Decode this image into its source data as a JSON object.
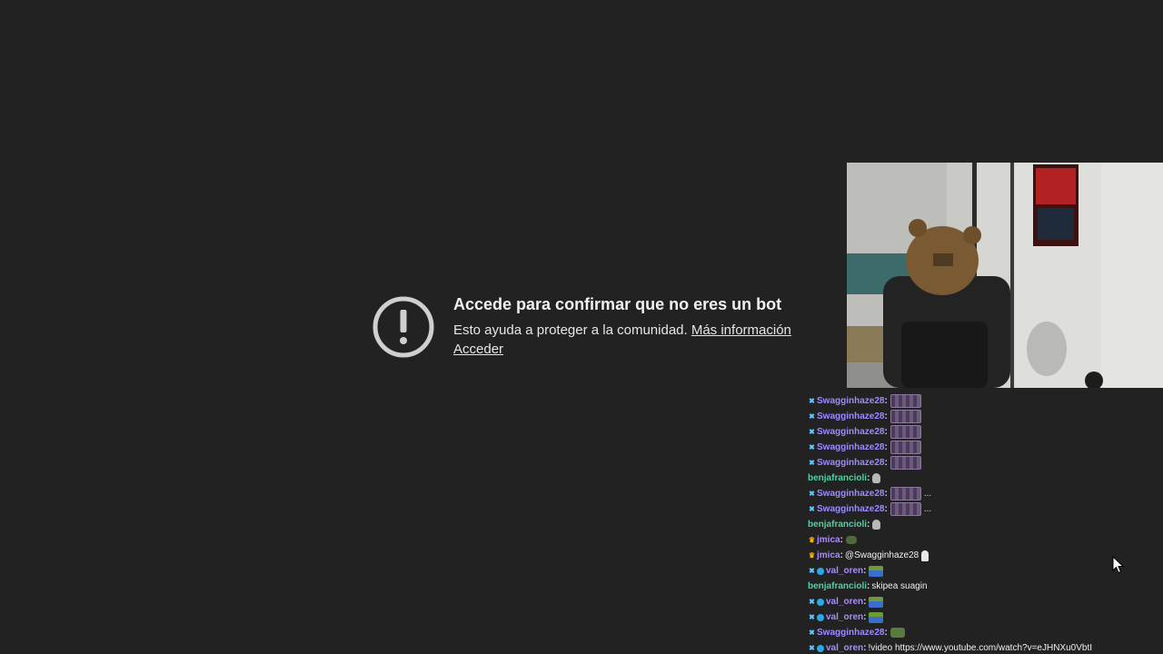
{
  "notice": {
    "title": "Accede para confirmar que no eres un bot",
    "body": "Esto ayuda a proteger a la comunidad.",
    "more_info_link": "Más información",
    "login_link": "Acceder",
    "icon": "alert-circle-icon"
  },
  "chat": {
    "messages": [
      {
        "user": "Swagginhaze28",
        "badges": [
          "mod"
        ],
        "color": "#9b8cff",
        "emotes": [
          "purple"
        ],
        "text": ""
      },
      {
        "user": "Swagginhaze28",
        "badges": [
          "mod"
        ],
        "color": "#9b8cff",
        "emotes": [
          "purple"
        ],
        "text": ""
      },
      {
        "user": "Swagginhaze28",
        "badges": [
          "mod"
        ],
        "color": "#9b8cff",
        "emotes": [
          "purple"
        ],
        "text": ""
      },
      {
        "user": "Swagginhaze28",
        "badges": [
          "mod"
        ],
        "color": "#9b8cff",
        "emotes": [
          "purple"
        ],
        "text": ""
      },
      {
        "user": "Swagginhaze28",
        "badges": [
          "mod"
        ],
        "color": "#9b8cff",
        "emotes": [
          "purple"
        ],
        "text": ""
      },
      {
        "user": "benjafrancioli",
        "badges": [],
        "color": "#4fd2a0",
        "emotes": [
          "skull"
        ],
        "text": ""
      },
      {
        "user": "Swagginhaze28",
        "badges": [
          "mod"
        ],
        "color": "#9b8cff",
        "emotes": [
          "purple"
        ],
        "text": "..."
      },
      {
        "user": "Swagginhaze28",
        "badges": [
          "mod"
        ],
        "color": "#9b8cff",
        "emotes": [
          "purple"
        ],
        "text": "..."
      },
      {
        "user": "benjafrancioli",
        "badges": [],
        "color": "#4fd2a0",
        "emotes": [
          "skull"
        ],
        "text": ""
      },
      {
        "user": "jmica",
        "badges": [
          "crown"
        ],
        "color": "#a98bff",
        "emotes": [
          "frog"
        ],
        "text": ""
      },
      {
        "user": "jmica",
        "badges": [
          "crown"
        ],
        "color": "#a98bff",
        "emotes": [
          "ghost"
        ],
        "text": "@Swagginhaze28"
      },
      {
        "user": "val_oren",
        "badges": [
          "mod",
          "gem"
        ],
        "color": "#a98bff",
        "emotes": [
          "blue"
        ],
        "text": ""
      },
      {
        "user": "benjafrancioli",
        "badges": [],
        "color": "#4fd2a0",
        "emotes": [],
        "text": "skipea suagin"
      },
      {
        "user": "val_oren",
        "badges": [
          "mod",
          "gem"
        ],
        "color": "#a98bff",
        "emotes": [
          "blue"
        ],
        "text": ""
      },
      {
        "user": "val_oren",
        "badges": [
          "mod",
          "gem"
        ],
        "color": "#a98bff",
        "emotes": [
          "blue"
        ],
        "text": ""
      },
      {
        "user": "Swagginhaze28",
        "badges": [
          "mod"
        ],
        "color": "#9b8cff",
        "emotes": [
          "pepe"
        ],
        "text": ""
      },
      {
        "user": "val_oren",
        "badges": [
          "mod",
          "gem"
        ],
        "color": "#a98bff",
        "emotes": [],
        "text": "!video https://www.youtube.com/watch?v=eJHNXu0VbtI"
      }
    ]
  },
  "colors": {
    "background": "#222223",
    "mod_badge": "#5cc8ff",
    "crown_badge": "#f5b400",
    "green_user": "#4fd2a0",
    "purple_user": "#9b8cff"
  }
}
